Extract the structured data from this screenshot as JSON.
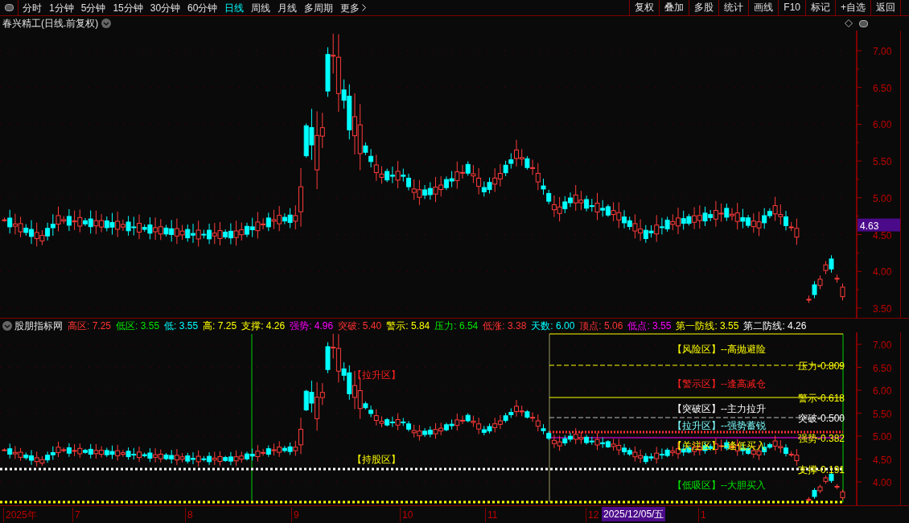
{
  "toolbar": {
    "periods": [
      {
        "label": "分时",
        "selected": false
      },
      {
        "label": "1分钟",
        "selected": false
      },
      {
        "label": "5分钟",
        "selected": false
      },
      {
        "label": "15分钟",
        "selected": false
      },
      {
        "label": "30分钟",
        "selected": false
      },
      {
        "label": "60分钟",
        "selected": false
      },
      {
        "label": "日线",
        "selected": true
      },
      {
        "label": "周线",
        "selected": false
      },
      {
        "label": "月线",
        "selected": false
      },
      {
        "label": "多周期",
        "selected": false
      }
    ],
    "more": "更多",
    "actions": [
      "复权",
      "叠加",
      "多股",
      "统计",
      "画线",
      "F10",
      "标记",
      "+自选",
      "返回"
    ]
  },
  "main_chart": {
    "title": "春兴精工(日线.前复权)",
    "price_axis": [
      "7.00",
      "6.50",
      "6.00",
      "5.50",
      "5.00",
      "4.50",
      "4.00",
      "3.50"
    ],
    "current_price": "4.63"
  },
  "indicator": {
    "name": "股朋指标网",
    "values": [
      {
        "text": "高区: 7.25",
        "color": "#ff3232"
      },
      {
        "text": "低区: 3.55",
        "color": "#00e600"
      },
      {
        "text": "低: 3.55",
        "color": "#00ffff"
      },
      {
        "text": "高: 7.25",
        "color": "#ffff00"
      },
      {
        "text": "支撑: 4.26",
        "color": "#ffff00"
      },
      {
        "text": "强势: 4.96",
        "color": "#ff00ff"
      },
      {
        "text": "突破: 5.40",
        "color": "#ff3232"
      },
      {
        "text": "警示: 5.84",
        "color": "#ffff00"
      },
      {
        "text": "压力: 6.54",
        "color": "#00e600"
      },
      {
        "text": "低涨: 3.38",
        "color": "#ff3232"
      },
      {
        "text": "天数: 6.00",
        "color": "#00ffff"
      },
      {
        "text": "顶点: 5.06",
        "color": "#ff3232"
      },
      {
        "text": "低点: 3.55",
        "color": "#ff00ff"
      },
      {
        "text": "第一防线: 3.55",
        "color": "#ffff00"
      },
      {
        "text": "第二防线: 4.26",
        "color": "#ffffff"
      }
    ],
    "price_axis": [
      "7.00",
      "6.50",
      "6.00",
      "5.50",
      "5.00",
      "4.50",
      "4.00"
    ],
    "zones": [
      {
        "text": "【风险区】--高抛避险",
        "color": "#ffff00"
      },
      {
        "text": "【警示区】--逢高减仓",
        "color": "#ff2020"
      },
      {
        "text": "【突破区】--主力拉升",
        "color": "#ffffff"
      },
      {
        "text": "【拉升区】--强势蓄锐",
        "color": "#7fffff"
      },
      {
        "text": "【关注区】--逢低买入",
        "color": "#ffff00"
      },
      {
        "text": "【低吸区】--大胆买入",
        "color": "#00e600"
      }
    ],
    "levels": [
      {
        "text": "压力-0.809",
        "color": "#ffff00"
      },
      {
        "text": "警示-0.618",
        "color": "#ffff00"
      },
      {
        "text": "突破-0.500",
        "color": "#ffffff"
      },
      {
        "text": "强势-0.382",
        "color": "#ffff00"
      },
      {
        "text": "支撑-0.191",
        "color": "#ffff00"
      }
    ],
    "markers": [
      {
        "text": "【拉升区】",
        "color": "#ff2020"
      },
      {
        "text": "【持股区】",
        "color": "#ffff00"
      }
    ]
  },
  "date_axis": {
    "labels": [
      "2025年",
      "7",
      "8",
      "9",
      "10",
      "11",
      "12"
    ],
    "cursor_date": "2025/12/05/五",
    "after": [
      "1"
    ]
  }
}
